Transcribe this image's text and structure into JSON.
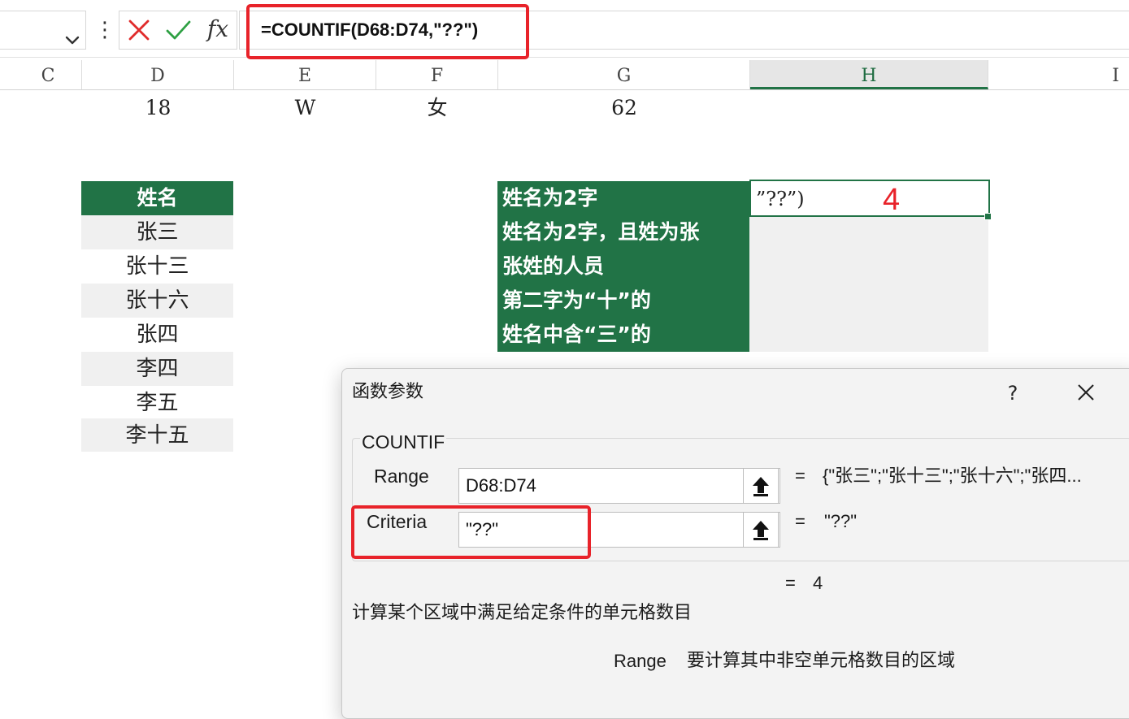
{
  "formula_bar": {
    "dots": "⋮",
    "fx_label": "fx",
    "formula": "=COUNTIF(D68:D74,\"??\")"
  },
  "columns": [
    "C",
    "D",
    "E",
    "F",
    "G",
    "H",
    "I"
  ],
  "active_column": "H",
  "row_values": {
    "d": "18",
    "e": "W",
    "f": "女",
    "g": "62"
  },
  "names": {
    "header": "姓名",
    "items": [
      "张三",
      "张十三",
      "张十六",
      "张四",
      "李四",
      "李五",
      "李十五"
    ]
  },
  "conditions": [
    "姓名为2字",
    "姓名为2字，且姓为张",
    "张姓的人员",
    "第二字为“十”的",
    "姓名中含“三”的"
  ],
  "active_cell": {
    "edit_text": "”??”)",
    "result": "4"
  },
  "dialog": {
    "title": "函数参数",
    "help": "?",
    "function_name": "COUNTIF",
    "args": [
      {
        "label": "Range",
        "value": "D68:D74",
        "eq": "=",
        "result": "{\"张三\";\"张十三\";\"张十六\";\"张四..."
      },
      {
        "label": "Criteria",
        "value": "\"??\"",
        "eq": "=",
        "result": "\"??\""
      }
    ],
    "total_eq": "=",
    "total": "4",
    "description": "计算某个区域中满足给定条件的单元格数目",
    "arg_help_name": "Range",
    "arg_help_text": "要计算其中非空单元格数目的区域"
  },
  "colors": {
    "excel_green": "#217346",
    "highlight_red": "#e8232a",
    "cancel_red": "#e02b2b",
    "confirm_green": "#2ea043"
  }
}
